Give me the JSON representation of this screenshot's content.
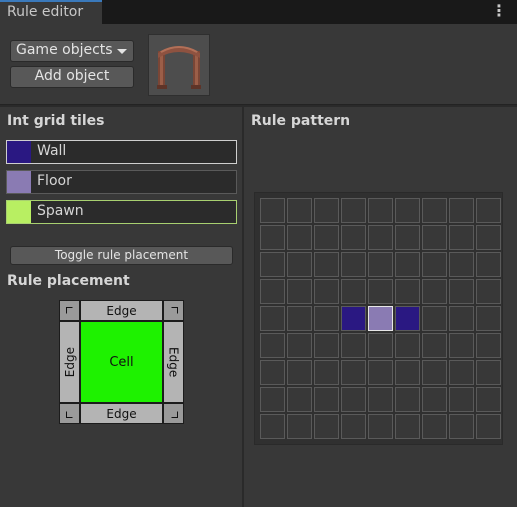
{
  "window": {
    "tab_title": "Rule editor",
    "menu_icon": "more-vertical-icon"
  },
  "objects": {
    "dropdown_label": "Game objects",
    "add_button_label": "Add object",
    "thumbnail_icon": "stone-archway-icon"
  },
  "int_grid": {
    "heading": "Int grid tiles",
    "tiles": [
      {
        "label": "Wall",
        "color": "#2a1882",
        "selected": true
      },
      {
        "label": "Floor",
        "color": "#8a7bb3",
        "selected": false
      },
      {
        "label": "Spawn",
        "color": "#b8ef62",
        "selected": false
      }
    ]
  },
  "toggle_button_label": "Toggle rule placement",
  "placement": {
    "heading": "Rule placement",
    "edge_top": "Edge",
    "edge_bottom": "Edge",
    "edge_left": "Edge",
    "edge_right": "Edge",
    "cell": "Cell",
    "cell_color": "#1ef200"
  },
  "pattern": {
    "heading": "Rule pattern",
    "rows": 9,
    "cols": 9,
    "filled": [
      {
        "row": 4,
        "col": 3,
        "tile": "Wall"
      },
      {
        "row": 4,
        "col": 4,
        "tile": "Floor"
      },
      {
        "row": 4,
        "col": 5,
        "tile": "Wall"
      }
    ]
  }
}
